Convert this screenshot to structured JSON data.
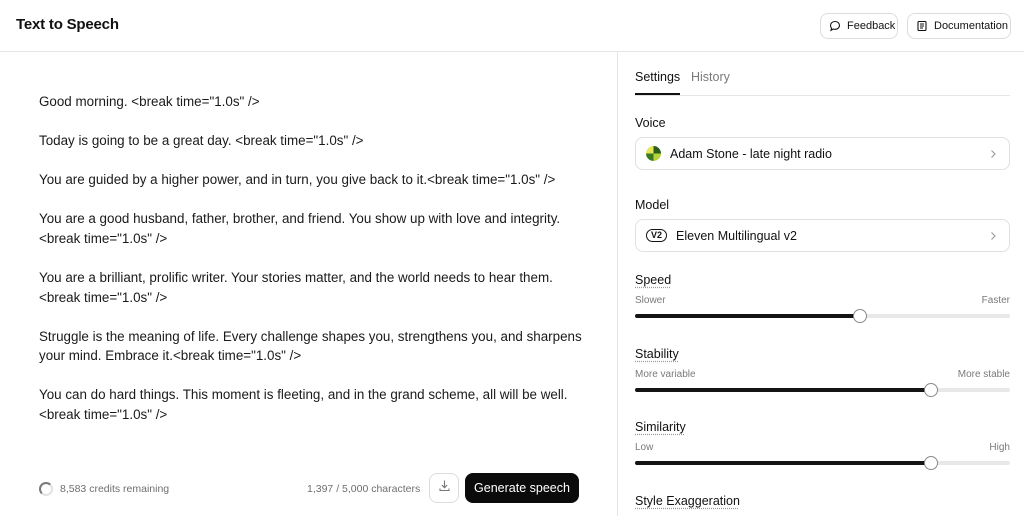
{
  "header": {
    "title": "Text to Speech",
    "feedback_label": "Feedback",
    "documentation_label": "Documentation"
  },
  "editor": {
    "paragraphs": [
      "Good morning. <break time=\"1.0s\" />",
      "Today is going to be a great day. <break time=\"1.0s\" />",
      "You are guided by a higher power, and in turn, you give back to it.<break time=\"1.0s\" />",
      "You are a good husband, father, brother, and friend. You show up with love and integrity.<break time=\"1.0s\" />",
      "You are a brilliant, prolific writer. Your stories matter, and the world needs to hear them. <break time=\"1.0s\" />",
      "Struggle is the meaning of life. Every challenge shapes you, strengthens you, and sharpens your mind. Embrace it.<break time=\"1.0s\" />",
      "You can do hard things. This moment is fleeting, and in the grand scheme, all will be well. <break time=\"1.0s\" />"
    ]
  },
  "footer": {
    "credits": "8,583 credits remaining",
    "characters": "1,397 / 5,000 characters",
    "generate_label": "Generate speech"
  },
  "panel": {
    "tabs": [
      "Settings",
      "History"
    ],
    "active_tab": "Settings",
    "voice": {
      "label": "Voice",
      "value": "Adam Stone - late night radio"
    },
    "model": {
      "label": "Model",
      "badge": "V2",
      "value": "Eleven Multilingual v2"
    },
    "speed": {
      "label": "Speed",
      "min_label": "Slower",
      "max_label": "Faster",
      "value": 0.6
    },
    "stability": {
      "label": "Stability",
      "min_label": "More variable",
      "max_label": "More stable",
      "value": 0.79
    },
    "similarity": {
      "label": "Similarity",
      "min_label": "Low",
      "max_label": "High",
      "value": 0.79
    },
    "style_exaggeration": {
      "label": "Style Exaggeration"
    }
  },
  "colors": {
    "accent": "#0b0b0b",
    "border": "#e5e5e5",
    "muted_text": "#7a7a7a",
    "slider_track": "#e8e8e8"
  },
  "icons": {
    "feedback": "speech-bubble-icon",
    "documentation": "document-icon",
    "download": "download-icon",
    "chevron": "chevron-right-icon",
    "spinner": "loading-spinner-icon",
    "voice_avatar": "voice-avatar-icon"
  }
}
